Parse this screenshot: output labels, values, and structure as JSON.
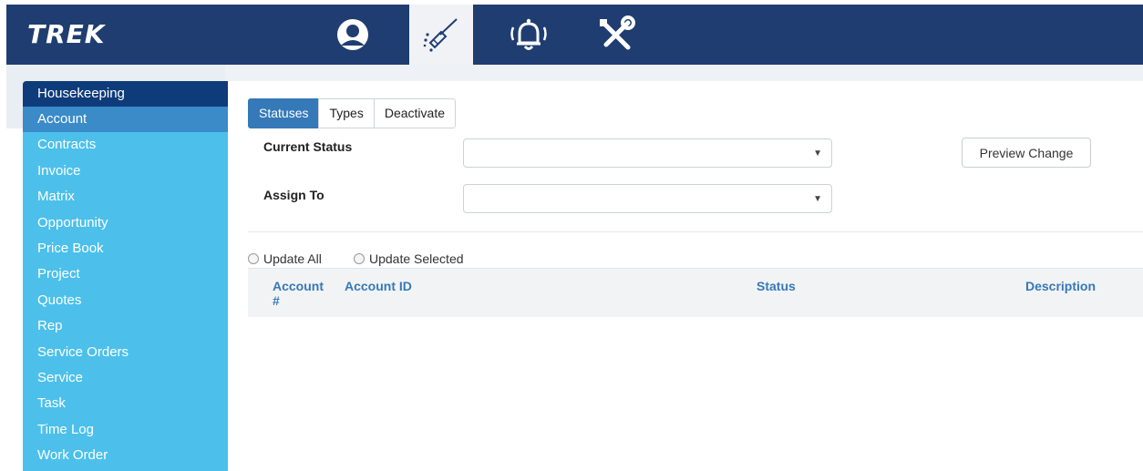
{
  "brand": {
    "logo": "TREK"
  },
  "nav": {
    "icons": [
      "user-icon",
      "broom-icon",
      "bell-icon",
      "tools-icon"
    ]
  },
  "sidebar": {
    "header": "Housekeeping",
    "items": [
      {
        "label": "Account",
        "active": true
      },
      {
        "label": "Contracts"
      },
      {
        "label": "Invoice"
      },
      {
        "label": "Matrix"
      },
      {
        "label": "Opportunity"
      },
      {
        "label": "Price Book"
      },
      {
        "label": "Project"
      },
      {
        "label": "Quotes"
      },
      {
        "label": "Rep"
      },
      {
        "label": "Service Orders"
      },
      {
        "label": "Service"
      },
      {
        "label": "Task"
      },
      {
        "label": "Time Log"
      },
      {
        "label": "Work Order"
      }
    ]
  },
  "tabs": [
    {
      "label": "Statuses",
      "active": true
    },
    {
      "label": "Types"
    },
    {
      "label": "Deactivate"
    }
  ],
  "form": {
    "current_status_label": "Current Status",
    "current_status_value": "",
    "assign_to_label": "Assign To",
    "assign_to_value": "",
    "preview_button": "Preview Change"
  },
  "update": {
    "all_label": "Update All",
    "selected_label": "Update Selected"
  },
  "table": {
    "col_account_no_line1": "Account",
    "col_account_no_line2": "#",
    "col_account_id": "Account ID",
    "col_status": "Status",
    "col_description": "Description"
  },
  "colors": {
    "topbar": "#1f3d70",
    "sidebar": "#4cc0ea",
    "sidebar_header": "#0e3b7a",
    "accent": "#3579b8"
  }
}
